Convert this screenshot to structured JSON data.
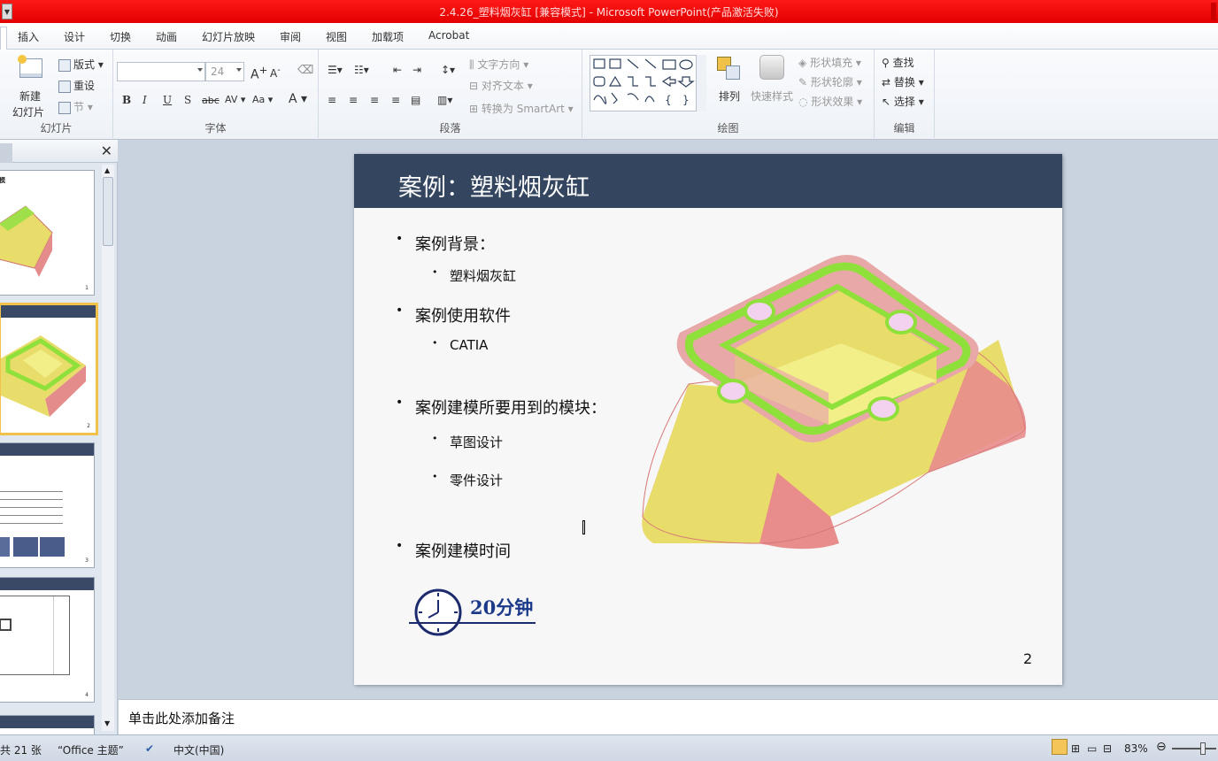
{
  "window": {
    "title": "2.4.26_塑料烟灰缸 [兼容模式] - Microsoft PowerPoint(产品激活失败)"
  },
  "tabs": [
    "插入",
    "设计",
    "切换",
    "动画",
    "幻灯片放映",
    "审阅",
    "视图",
    "加载项",
    "Acrobat"
  ],
  "ribbon": {
    "slides": {
      "new_slide_line1": "新建",
      "new_slide_line2": "幻灯片",
      "layout": "版式",
      "reset": "重设",
      "section": "节",
      "label": "幻灯片"
    },
    "font": {
      "size": "24",
      "label": "字体"
    },
    "paragraph": {
      "text_direction": "文字方向",
      "align_text": "对齐文本",
      "convert_smartart": "转换为 SmartArt",
      "label": "段落"
    },
    "drawing": {
      "arrange": "排列",
      "quick_styles": "快速样式",
      "shape_fill": "形状填充",
      "shape_outline": "形状轮廓",
      "shape_effects": "形状效果",
      "label": "绘图"
    },
    "editing": {
      "find": "查找",
      "replace": "替换",
      "select": "选择",
      "label": "编辑"
    }
  },
  "slide": {
    "title": "案例：塑料烟灰缸",
    "b1": "案例背景：",
    "b1_sub": "塑料烟灰缸",
    "b2": "案例使用软件",
    "b2_sub": "CATIA",
    "b3": "案例建模所要用到的模块：",
    "b3_sub1": "草图设计",
    "b3_sub2": "零件设计",
    "b4": "案例建模时间",
    "time": "20分钟",
    "page": "2"
  },
  "notes": {
    "placeholder": "单击此处添加备注"
  },
  "status": {
    "slide_count": "共 21 张",
    "theme": "“Office 主题”",
    "language": "中文(中国)",
    "zoom": "83%"
  },
  "colors": {
    "title_bar": "#e40000",
    "slide_banner": "#34465f",
    "selected_thumb": "#f1c24a"
  }
}
